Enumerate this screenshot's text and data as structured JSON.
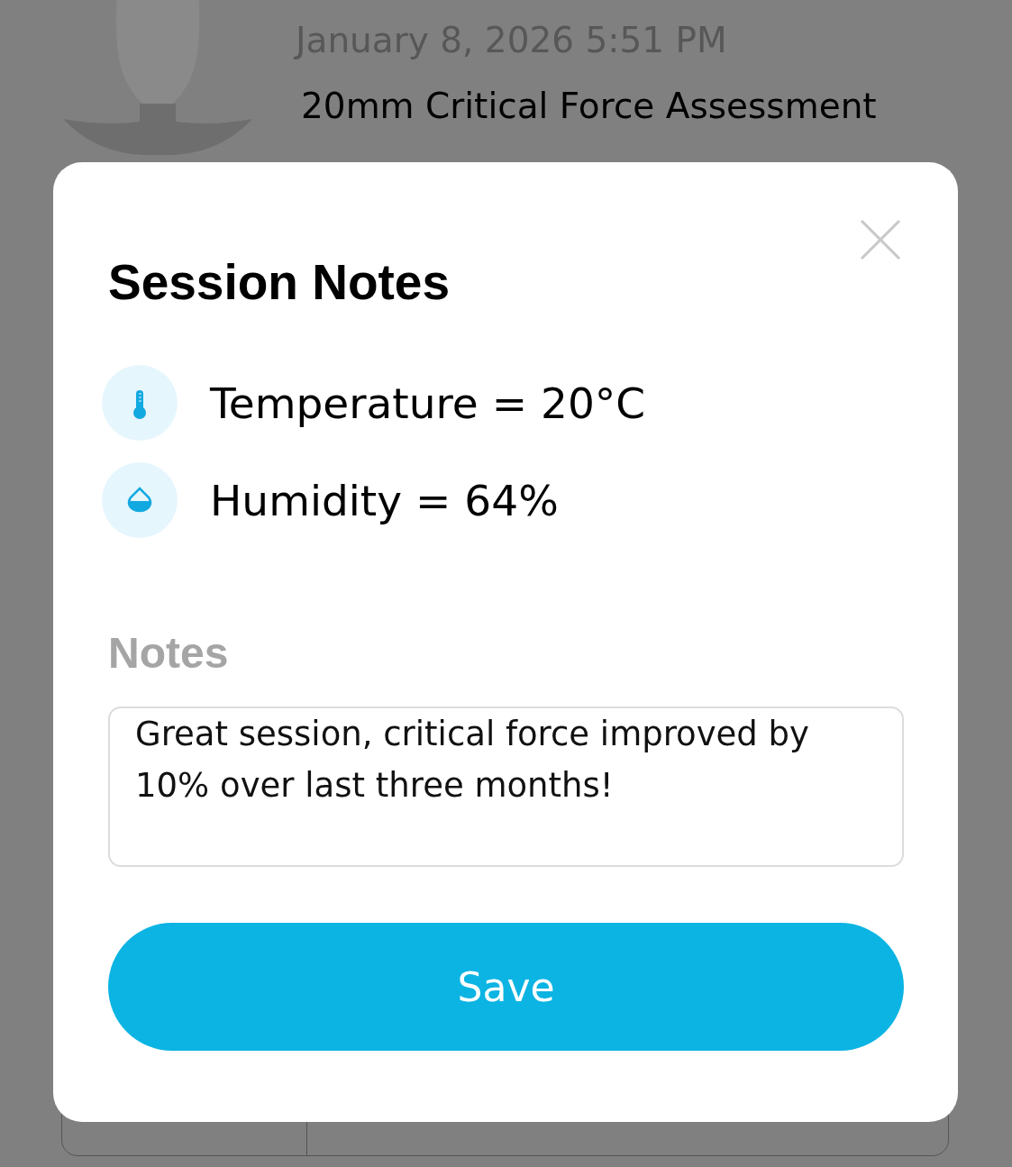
{
  "background": {
    "date": "January 8, 2026 5:51 PM",
    "title": "20mm Critical Force Assessment"
  },
  "dialog": {
    "title": "Session Notes",
    "readings": [
      {
        "kind": "temperature",
        "text": "Temperature = 20°C"
      },
      {
        "kind": "humidity",
        "text": "Humidity = 64%"
      }
    ],
    "notes_label": "Notes",
    "notes": "Great session, critical force improved by 10% over last three months!",
    "save_button": "Save"
  }
}
